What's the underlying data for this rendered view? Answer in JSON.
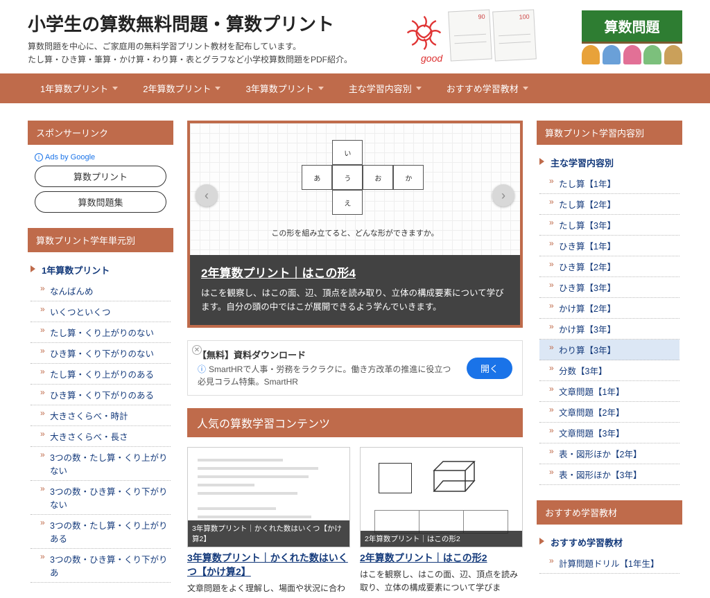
{
  "header": {
    "title": "小学生の算数無料問題・算数プリント",
    "sub1": "算数問題を中心に、ご家庭用の無料学習プリント教材を配布しています。",
    "sub2": "たし算・ひき算・筆算・かけ算・わり算・表とグラフなど小学校算数問題をPDF紹介。",
    "badge": "算数問題",
    "good": "good",
    "score1": "90",
    "score2": "100"
  },
  "nav": [
    "1年算数プリント",
    "2年算数プリント",
    "3年算数プリント",
    "主な学習内容別",
    "おすすめ学習教材"
  ],
  "left": {
    "sponsor_head": "スポンサーリンク",
    "ads_by": "Ads by Google",
    "ad_pills": [
      "算数プリント",
      "算数問題集"
    ],
    "unit_head": "算数プリント学年単元別",
    "unit_top": "1年算数プリント",
    "unit_items": [
      "なんばんめ",
      "いくつといくつ",
      "たし算・くり上がりのない",
      "ひき算・くり下がりのない",
      "たし算・くり上がりのある",
      "ひき算・くり下がりのある",
      "大きさくらべ・時計",
      "大きさくらべ・長さ",
      "3つの数・たし算・くり上がりない",
      "3つの数・ひき算・くり下がりない",
      "3つの数・たし算・くり上がりある",
      "3つの数・ひき算・くり下がりあ"
    ]
  },
  "slider": {
    "faces": [
      "い",
      "あ",
      "う",
      "お",
      "か",
      "え"
    ],
    "question": "この形を組み立てると、どんな形ができますか。",
    "title": "2年算数プリント｜はこの形4",
    "desc": "はこを観察し、はこの面、辺、頂点を読み取り、立体の構成要素について学びます。自分の頭の中ではこが展開できるよう学んでいきます。"
  },
  "inline_ad": {
    "title": "【無料】資料ダウンロード",
    "desc": "SmartHRで人事・労務をラクラクに。働き方改革の推進に役立つ必見コラム特集。SmartHR",
    "btn": "開く"
  },
  "popular": {
    "head": "人気の算数学習コンテンツ",
    "cards": [
      {
        "ov": "3年算数プリント｜かくれた数はいくつ【かけ算2】",
        "title": "3年算数プリント｜かくれた数はいくつ【かけ算2】",
        "desc": "文章問題をよく理解し、場面や状況に合わ"
      },
      {
        "ov": "2年算数プリント｜はこの形2",
        "title": "2年算数プリント｜はこの形2",
        "desc": "はこを観察し、はこの面、辺、頂点を読み取り、立体の構成要素について学びま"
      }
    ]
  },
  "right": {
    "cat_head": "算数プリント学習内容別",
    "cat_top": "主な学習内容別",
    "cat_items": [
      "たし算【1年】",
      "たし算【2年】",
      "たし算【3年】",
      "ひき算【1年】",
      "ひき算【2年】",
      "ひき算【3年】",
      "かけ算【2年】",
      "かけ算【3年】",
      "わり算【3年】",
      "分数【3年】",
      "文章問題【1年】",
      "文章問題【2年】",
      "文章問題【3年】",
      "表・図形ほか【2年】",
      "表・図形ほか【3年】"
    ],
    "rec_head": "おすすめ学習教材",
    "rec_top": "おすすめ学習教材",
    "rec_items": [
      "計算問題ドリル【1年生】"
    ]
  }
}
